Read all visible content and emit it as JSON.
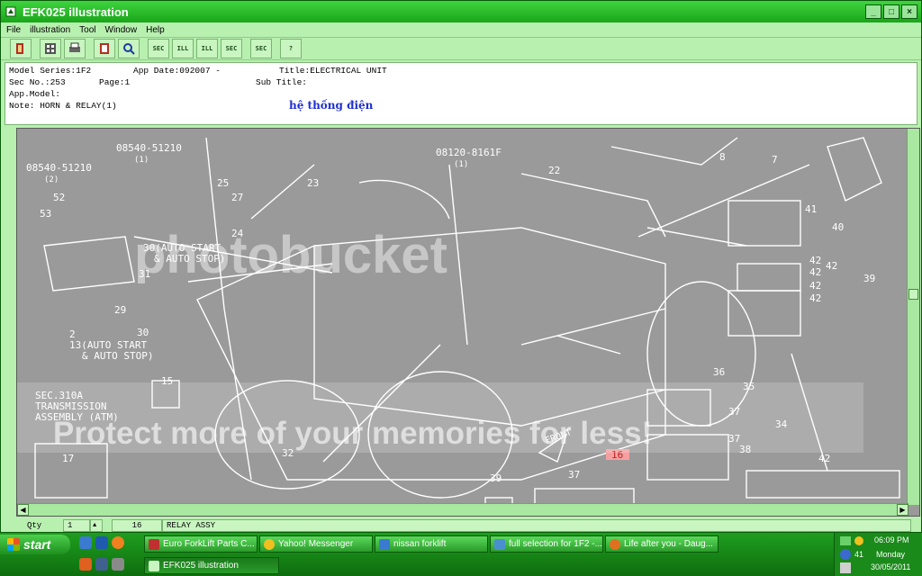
{
  "window": {
    "title": "EFK025 illustration",
    "controls": [
      "_",
      "□",
      "×"
    ]
  },
  "menu": [
    "File",
    "illustration",
    "Tool",
    "Window",
    "Help"
  ],
  "toolbar": [
    {
      "name": "exit-icon",
      "label": ""
    },
    {
      "name": "calculator-icon",
      "label": ""
    },
    {
      "name": "print-icon",
      "label": ""
    },
    {
      "name": "book-icon",
      "label": ""
    },
    {
      "name": "search-icon",
      "label": ""
    },
    {
      "name": "sec-back-icon",
      "label": "SEC"
    },
    {
      "name": "ill-back-icon",
      "label": "ILL"
    },
    {
      "name": "ill-forward-icon",
      "label": "ILL"
    },
    {
      "name": "sec-forward-icon",
      "label": "SEC"
    },
    {
      "name": "sec-jump-icon",
      "label": "SEC"
    },
    {
      "name": "help-icon",
      "label": "?"
    }
  ],
  "info": {
    "model_series": "Model Series:1F2",
    "app_date": "App Date:092007 -",
    "title": "Title:ELECTRICAL UNIT",
    "sec_no": "Sec No.:253",
    "page": "Page:1",
    "sub_title": "Sub Title:",
    "app_model": "App.Model:",
    "note": "Note: HORN & RELAY(1)",
    "vietnamese": "hệ thống điện"
  },
  "diagram": {
    "callouts": [
      "08540-51210",
      "(1)",
      "08540-51210",
      "(2)",
      "08120-8161F",
      "(1)",
      "8",
      "7",
      "41",
      "40",
      "42",
      "42",
      "42",
      "42",
      "42",
      "39",
      "36",
      "35",
      "37",
      "34",
      "37",
      "38",
      "42",
      "39",
      "37",
      "52",
      "53",
      "25",
      "27",
      "23",
      "24",
      "22",
      "30(AUTO START",
      "& AUTO STOP)",
      "31",
      "29",
      "30",
      "2",
      "13(AUTO START",
      "& AUTO STOP)",
      "15",
      "SEC.310A",
      "TRANSMISSION",
      "ASSEMBLY (ATM)",
      "17",
      "32",
      "16",
      "FRONT"
    ],
    "selected_part": "16",
    "watermark_logo": "photobucket",
    "watermark_text": "Protect more of your memories for less!"
  },
  "status": {
    "qty_label": "Qty",
    "qty_value": "1",
    "part_no": "16",
    "part_name": "RELAY ASSY"
  },
  "taskbar": {
    "start": "start",
    "tasks": [
      "Euro ForkLift Parts C...",
      "Yahoo! Messenger",
      "nissan forklift",
      "full selection for 1F2 -...",
      "Life after you - Daug...",
      "EFK025 illustration"
    ],
    "clock": "06:09 PM",
    "day": "Monday",
    "date": "30/05/2011",
    "tray_num": "41"
  }
}
